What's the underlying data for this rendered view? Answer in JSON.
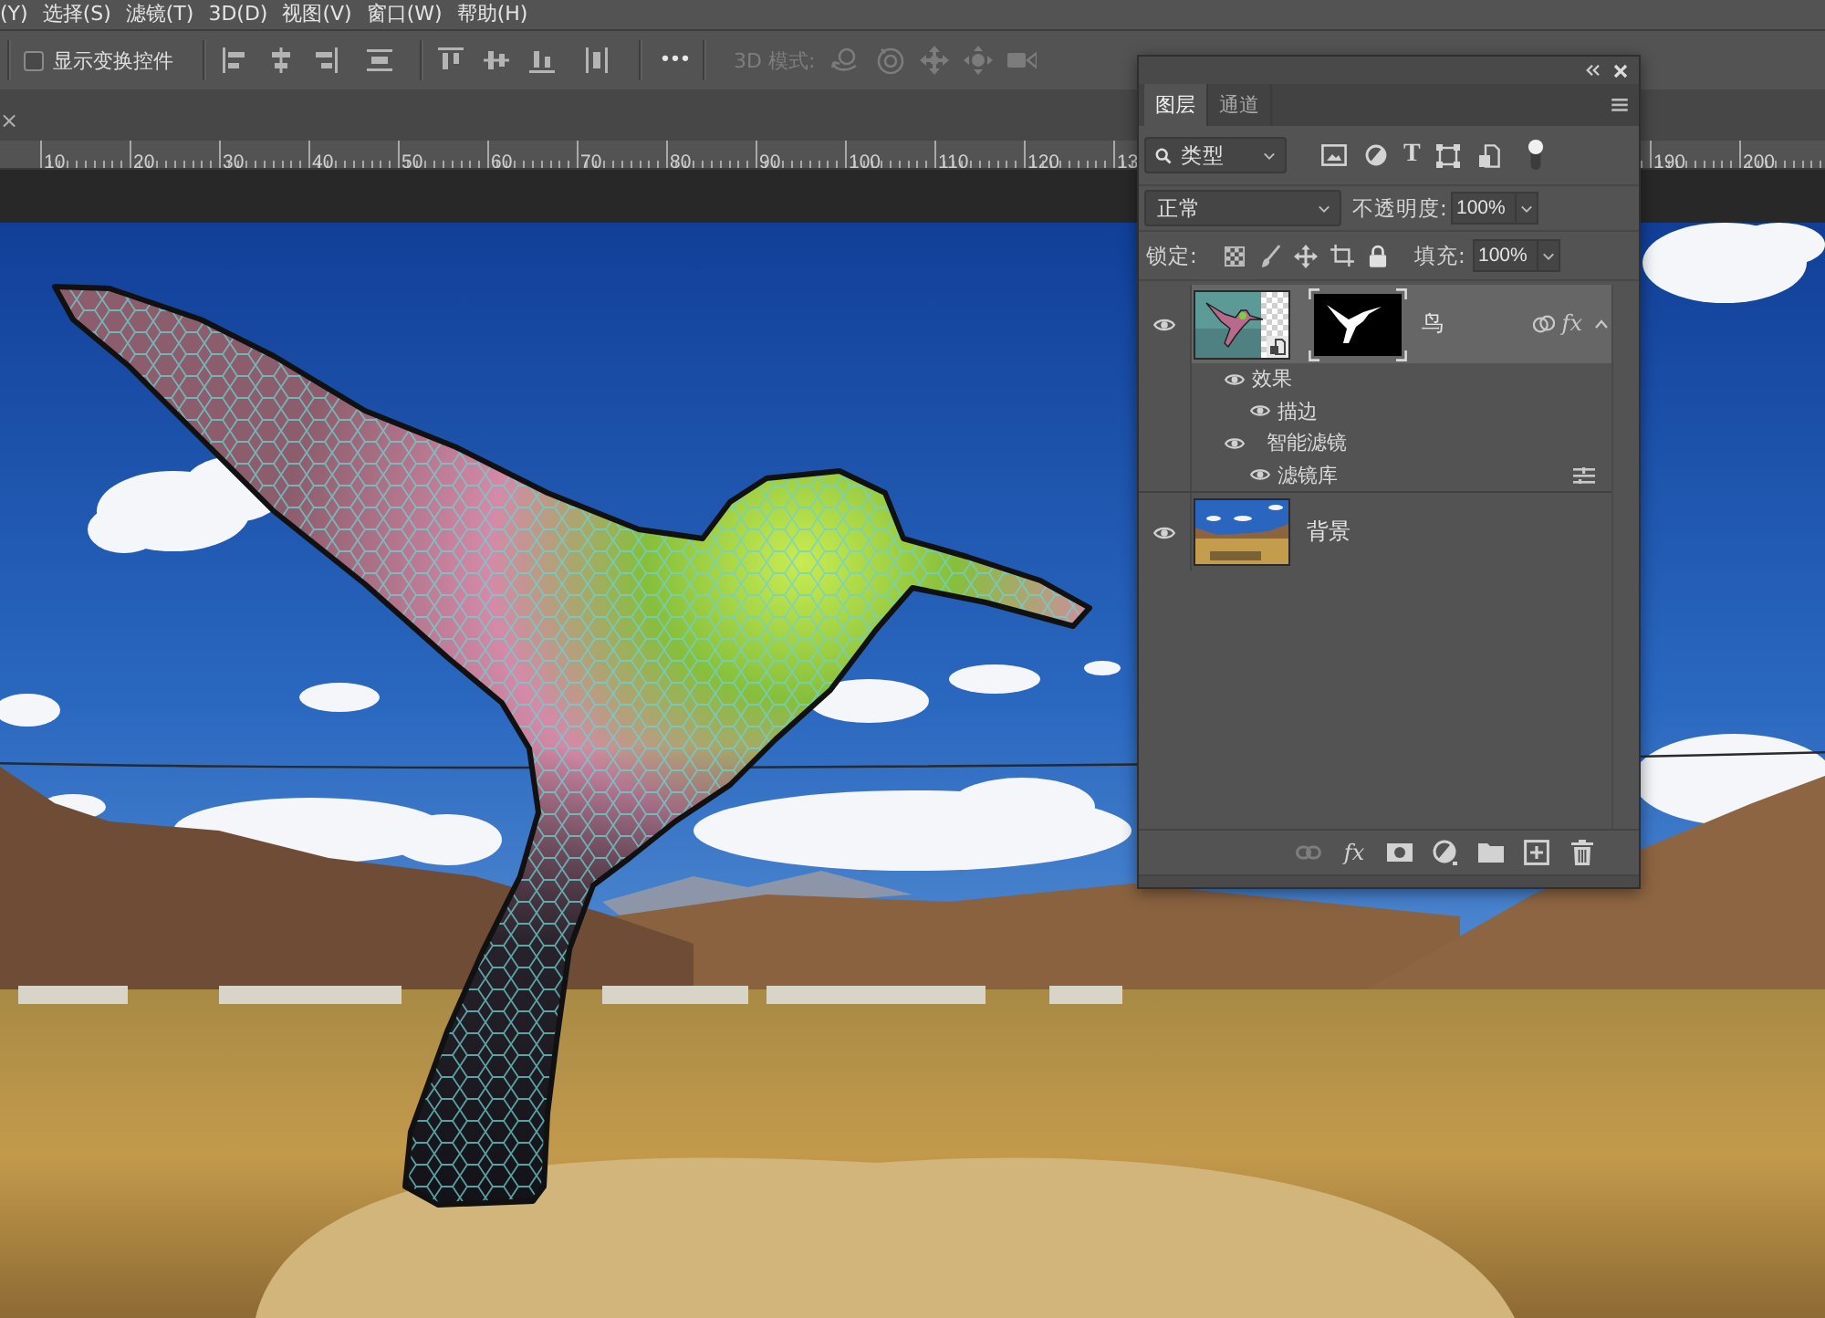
{
  "menu_bar": {
    "items": [
      "(Y)",
      "选择(S)",
      "滤镜(T)",
      "3D(D)",
      "视图(V)",
      "窗口(W)",
      "帮助(H)"
    ]
  },
  "options_bar": {
    "show_transform_controls": {
      "label": "显示变换控件",
      "checked": false
    },
    "more_button": "•••",
    "mode_3d": {
      "label": "3D 模式:",
      "disabled": true
    }
  },
  "document_tabs": {
    "close": "×"
  },
  "ruler": {
    "left_labels": [
      "10",
      "20",
      "30",
      "40",
      "50",
      "60",
      "70",
      "80",
      "90",
      "100",
      "110",
      "120",
      "13"
    ],
    "right_labels": [
      "190",
      "200"
    ]
  },
  "layers_panel": {
    "tabs": [
      {
        "label": "图层",
        "selected": true
      },
      {
        "label": "通道",
        "selected": false
      }
    ],
    "filter": {
      "value": "类型",
      "type_button": "T"
    },
    "blend_mode": {
      "value": "正常"
    },
    "opacity": {
      "label": "不透明度:",
      "value": "100%"
    },
    "lock": {
      "label": "锁定:"
    },
    "fill": {
      "label": "填充:",
      "value": "100%"
    },
    "layers": [
      {
        "name": "鸟",
        "kind": "smart_object",
        "selected": true,
        "visible": true,
        "expanded": true,
        "effects_badge": "fx",
        "children": [
          {
            "label": "效果",
            "kind": "effects",
            "visible": true,
            "children": [
              {
                "label": "描边",
                "kind": "effect",
                "visible": true
              }
            ]
          },
          {
            "label": "智能滤镜",
            "kind": "smart_filters",
            "visible": true,
            "children": [
              {
                "label": "滤镜库",
                "kind": "filter",
                "visible": true
              }
            ]
          }
        ]
      },
      {
        "name": "背景",
        "kind": "background",
        "selected": false,
        "visible": true
      }
    ],
    "footer_buttons": [
      {
        "kind": "link",
        "disabled": true
      },
      {
        "kind": "fx",
        "label": "fx",
        "disabled": false
      },
      {
        "kind": "mask",
        "disabled": false
      },
      {
        "kind": "adjustment",
        "disabled": false
      },
      {
        "kind": "group",
        "disabled": false
      },
      {
        "kind": "new",
        "disabled": false
      },
      {
        "kind": "delete",
        "disabled": false
      }
    ]
  }
}
